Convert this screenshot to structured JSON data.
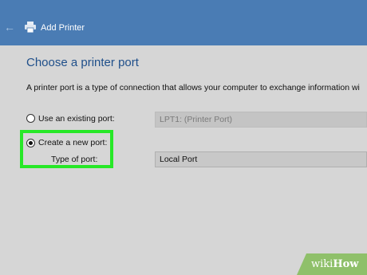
{
  "window": {
    "title": "Add Printer",
    "back_icon": "back-arrow-icon",
    "printer_icon": "printer-icon"
  },
  "main": {
    "heading": "Choose a printer port",
    "description": "A printer port is a type of connection that allows your computer to exchange information wi",
    "options": [
      {
        "label": "Use an existing port:",
        "checked": false,
        "value": "LPT1: (Printer Port)",
        "enabled": false
      },
      {
        "label": "Create a new port:",
        "checked": true
      }
    ],
    "type_of_port_label": "Type of port:",
    "type_of_port_value": "Local Port"
  },
  "watermark": {
    "brand": "wiki",
    "brand_bold": "How"
  },
  "colors": {
    "titlebar": "#4a7cb4",
    "heading": "#1f4f8a",
    "highlight": "#27e827",
    "background": "#d6d6d6"
  }
}
